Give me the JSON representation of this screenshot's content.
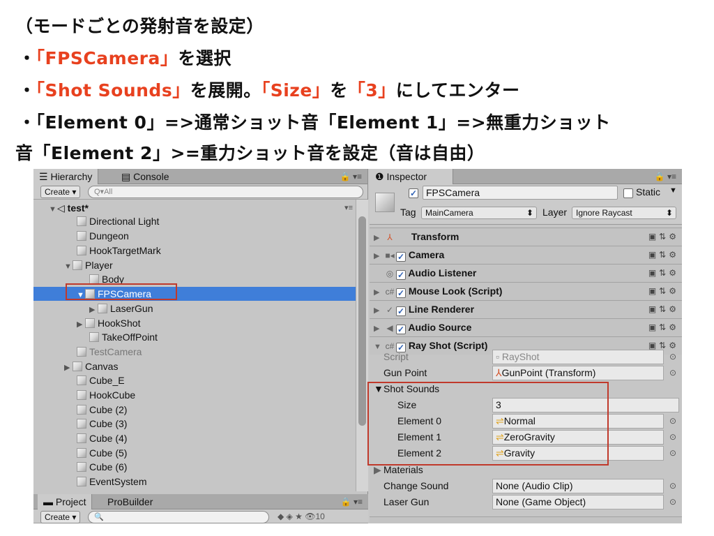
{
  "slide": {
    "line1": "（モードごとの発射音を設定）",
    "line2_bullet": "・",
    "line2_hl": "「FPSCamera」",
    "line2_rest": "を選択",
    "line3_bullet": "・",
    "line3_hl1": "「Shot Sounds」",
    "line3_mid1": "を展開。",
    "line3_hl2": "「Size」",
    "line3_mid2": "を",
    "line3_hl3": "「3」",
    "line3_rest": "にしてエンター",
    "line4": "・「Element 0」=>通常ショット音「Element 1」=>無重力ショット",
    "line5": "音「Element 2」>=重力ショット音を設定（音は自由）"
  },
  "hierarchy": {
    "tab_label": "Hierarchy",
    "console_label": "Console",
    "create_label": "Create",
    "search_placeholder": "Q▾All",
    "scene_name": "test*",
    "items": [
      {
        "label": "Directional Light"
      },
      {
        "label": "Dungeon"
      },
      {
        "label": "HookTargetMark"
      },
      {
        "label": "Player"
      },
      {
        "label": "Body"
      },
      {
        "label": "FPSCamera"
      },
      {
        "label": "LaserGun"
      },
      {
        "label": "HookShot"
      },
      {
        "label": "TakeOffPoint"
      },
      {
        "label": "TestCamera"
      },
      {
        "label": "Canvas"
      },
      {
        "label": "Cube_E"
      },
      {
        "label": "HookCube"
      },
      {
        "label": "Cube (2)"
      },
      {
        "label": "Cube (3)"
      },
      {
        "label": "Cube (4)"
      },
      {
        "label": "Cube (5)"
      },
      {
        "label": "Cube (6)"
      },
      {
        "label": "EventSystem"
      }
    ]
  },
  "project": {
    "tab_label": "Project",
    "probuilder_label": "ProBuilder",
    "create_label": "Create",
    "count": "10"
  },
  "inspector": {
    "tab_label": "Inspector",
    "object_name": "FPSCamera",
    "static_label": "Static",
    "tag_label": "Tag",
    "tag_value": "MainCamera",
    "layer_label": "Layer",
    "layer_value": "Ignore Raycast",
    "components": [
      {
        "label": "Transform"
      },
      {
        "label": "Camera"
      },
      {
        "label": "Audio Listener"
      },
      {
        "label": "Mouse Look (Script)"
      },
      {
        "label": "Line Renderer"
      },
      {
        "label": "Audio Source"
      },
      {
        "label": "Ray Shot (Script)"
      }
    ],
    "script_label": "Script",
    "script_value": "RayShot",
    "gunpoint_label": "Gun Point",
    "gunpoint_value": "GunPoint (Transform)",
    "shot_sounds_label": "Shot Sounds",
    "size_label": "Size",
    "size_value": "3",
    "elements": [
      {
        "label": "Element 0",
        "value": "Normal"
      },
      {
        "label": "Element 1",
        "value": "ZeroGravity"
      },
      {
        "label": "Element 2",
        "value": "Gravity"
      }
    ],
    "materials_label": "Materials",
    "change_sound_label": "Change Sound",
    "change_sound_value": "None (Audio Clip)",
    "laser_gun_label": "Laser Gun",
    "laser_gun_value": "None (Game Object)"
  },
  "colors": {
    "highlight": "#e8411f",
    "selection": "#3f7ed9",
    "box": "#c0392b"
  }
}
